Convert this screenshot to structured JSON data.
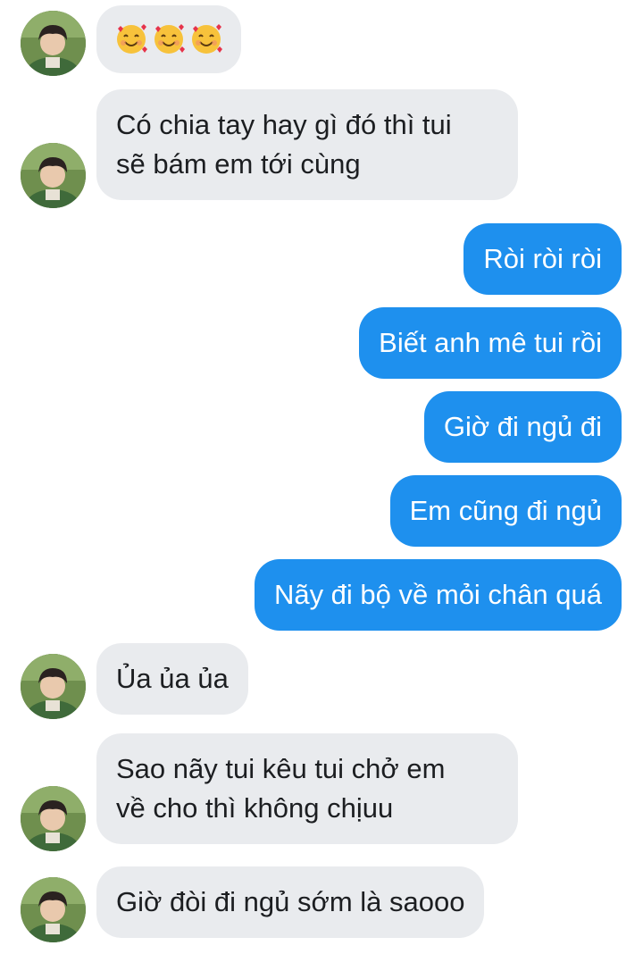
{
  "conversation": {
    "messages": [
      {
        "sender": "other",
        "type": "emoji",
        "emoji": [
          "smiling-face-with-hearts",
          "smiling-face-with-hearts",
          "smiling-face-with-hearts"
        ]
      },
      {
        "sender": "other",
        "type": "text",
        "lines": [
          "Có chia tay hay gì đó thì tui",
          "sẽ bám em tới cùng"
        ]
      },
      {
        "sender": "me",
        "type": "text",
        "lines": [
          "Ròi ròi ròi"
        ]
      },
      {
        "sender": "me",
        "type": "text",
        "lines": [
          "Biết anh mê tui rồi"
        ]
      },
      {
        "sender": "me",
        "type": "text",
        "lines": [
          "Giờ đi ngủ đi"
        ]
      },
      {
        "sender": "me",
        "type": "text",
        "lines": [
          "Em cũng đi ngủ"
        ]
      },
      {
        "sender": "me",
        "type": "text",
        "lines": [
          "Nãy đi bộ về mỏi chân quá"
        ]
      },
      {
        "sender": "other",
        "type": "text",
        "lines": [
          "Ủa ủa ủa"
        ]
      },
      {
        "sender": "other",
        "type": "text",
        "lines": [
          "Sao nãy tui kêu tui chở em",
          "về cho thì không chịuu"
        ]
      },
      {
        "sender": "other",
        "type": "text",
        "lines": [
          "Giờ đòi đi ngủ sớm là saooo"
        ]
      }
    ]
  },
  "colors": {
    "sent_bubble": "#1e90ee",
    "received_bubble": "#e9ebee",
    "received_text": "#1c1e21",
    "sent_text": "#ffffff"
  }
}
